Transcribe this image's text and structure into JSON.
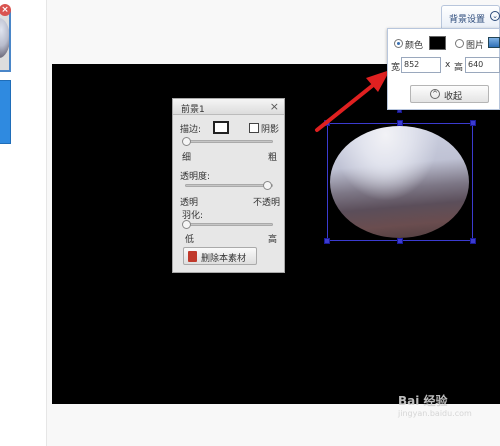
{
  "thumbnails": [
    {
      "delete_glyph": "×",
      "kind": "image"
    },
    {
      "kind": "selected-blank"
    }
  ],
  "foreground_panel": {
    "title": "前景1",
    "close_glyph": "×",
    "stroke_label": "描边:",
    "shadow_label": "阴影",
    "thin_label": "细",
    "thick_label": "粗",
    "opacity_label": "透明度:",
    "transparent_label": "透明",
    "opaque_label": "不透明",
    "feather_label": "羽化:",
    "low_label": "低",
    "high_label": "高",
    "delete_label": "删除本素材",
    "stroke_level": 0,
    "opacity_level": 1.0,
    "feather_level": 0
  },
  "background_settings": {
    "tab_label": "背景设置",
    "tab_icon": "chevron-circle-icon",
    "color_label": "颜色",
    "picture_label": "图片",
    "color_selected": true,
    "swatch_color": "#000000",
    "width_label": "宽",
    "width_value": "852",
    "times_glyph": "x",
    "height_label": "高",
    "height_value": "640",
    "collapse_label": "收起",
    "collapse_icon": "chevron-up-circle-icon"
  },
  "colors": {
    "canvas": "#000000",
    "selection": "#3b3bd0",
    "arrow": "#e02020"
  },
  "watermark": {
    "main": "Bai 经验",
    "sub": "jingyan.baidu.com"
  }
}
